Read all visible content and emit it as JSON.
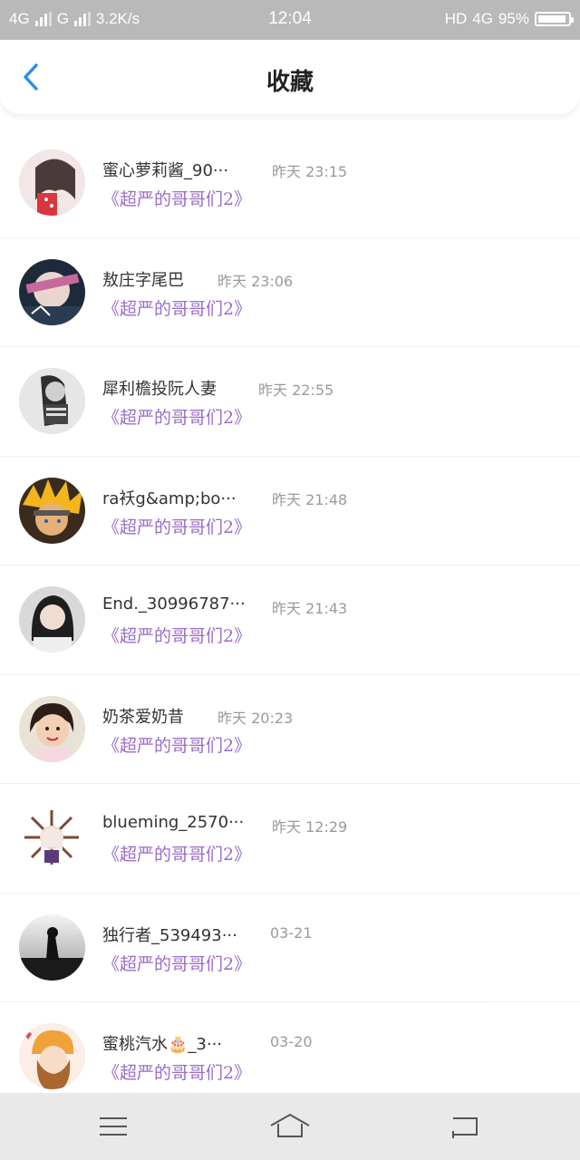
{
  "status_bar": {
    "network1": "4G",
    "network2": "G",
    "speed": "3.2K/s",
    "time": "12:04",
    "hd_label": "HD",
    "network3": "4G",
    "battery": "95%"
  },
  "header": {
    "title": "收藏",
    "back_icon": "chevron-left-icon",
    "accent_color": "#2a8fe8"
  },
  "list": {
    "items": [
      {
        "name": "蜜心萝莉酱_90···",
        "time": "昨天 23:15",
        "subtitle": "《超严的哥哥们2》"
      },
      {
        "name": "敖庄字尾巴",
        "time": "昨天 23:06",
        "subtitle": "《超严的哥哥们2》"
      },
      {
        "name": "犀利檐投阮人妻",
        "time": "昨天 22:55",
        "subtitle": "《超严的哥哥们2》"
      },
      {
        "name": "ra袄g&amp;bo···",
        "time": "昨天 21:48",
        "subtitle": "《超严的哥哥们2》"
      },
      {
        "name": "End._30996787···",
        "time": "昨天 21:43",
        "subtitle": "《超严的哥哥们2》"
      },
      {
        "name": "奶茶爱奶昔",
        "time": "昨天 20:23",
        "subtitle": "《超严的哥哥们2》"
      },
      {
        "name": "blueming_2570···",
        "time": "昨天 12:29",
        "subtitle": "《超严的哥哥们2》"
      },
      {
        "name": "独行者_539493···",
        "time": "03-21",
        "subtitle": "《超严的哥哥们2》"
      },
      {
        "name": "蜜桃汽水🎂_3···",
        "time": "03-20",
        "subtitle": "《超严的哥哥们2》"
      }
    ],
    "subtitle_color": "#9b6cc9"
  },
  "nav": {
    "menu_icon": "menu-icon",
    "home_icon": "home-icon",
    "back_icon": "back-arrow-icon"
  }
}
